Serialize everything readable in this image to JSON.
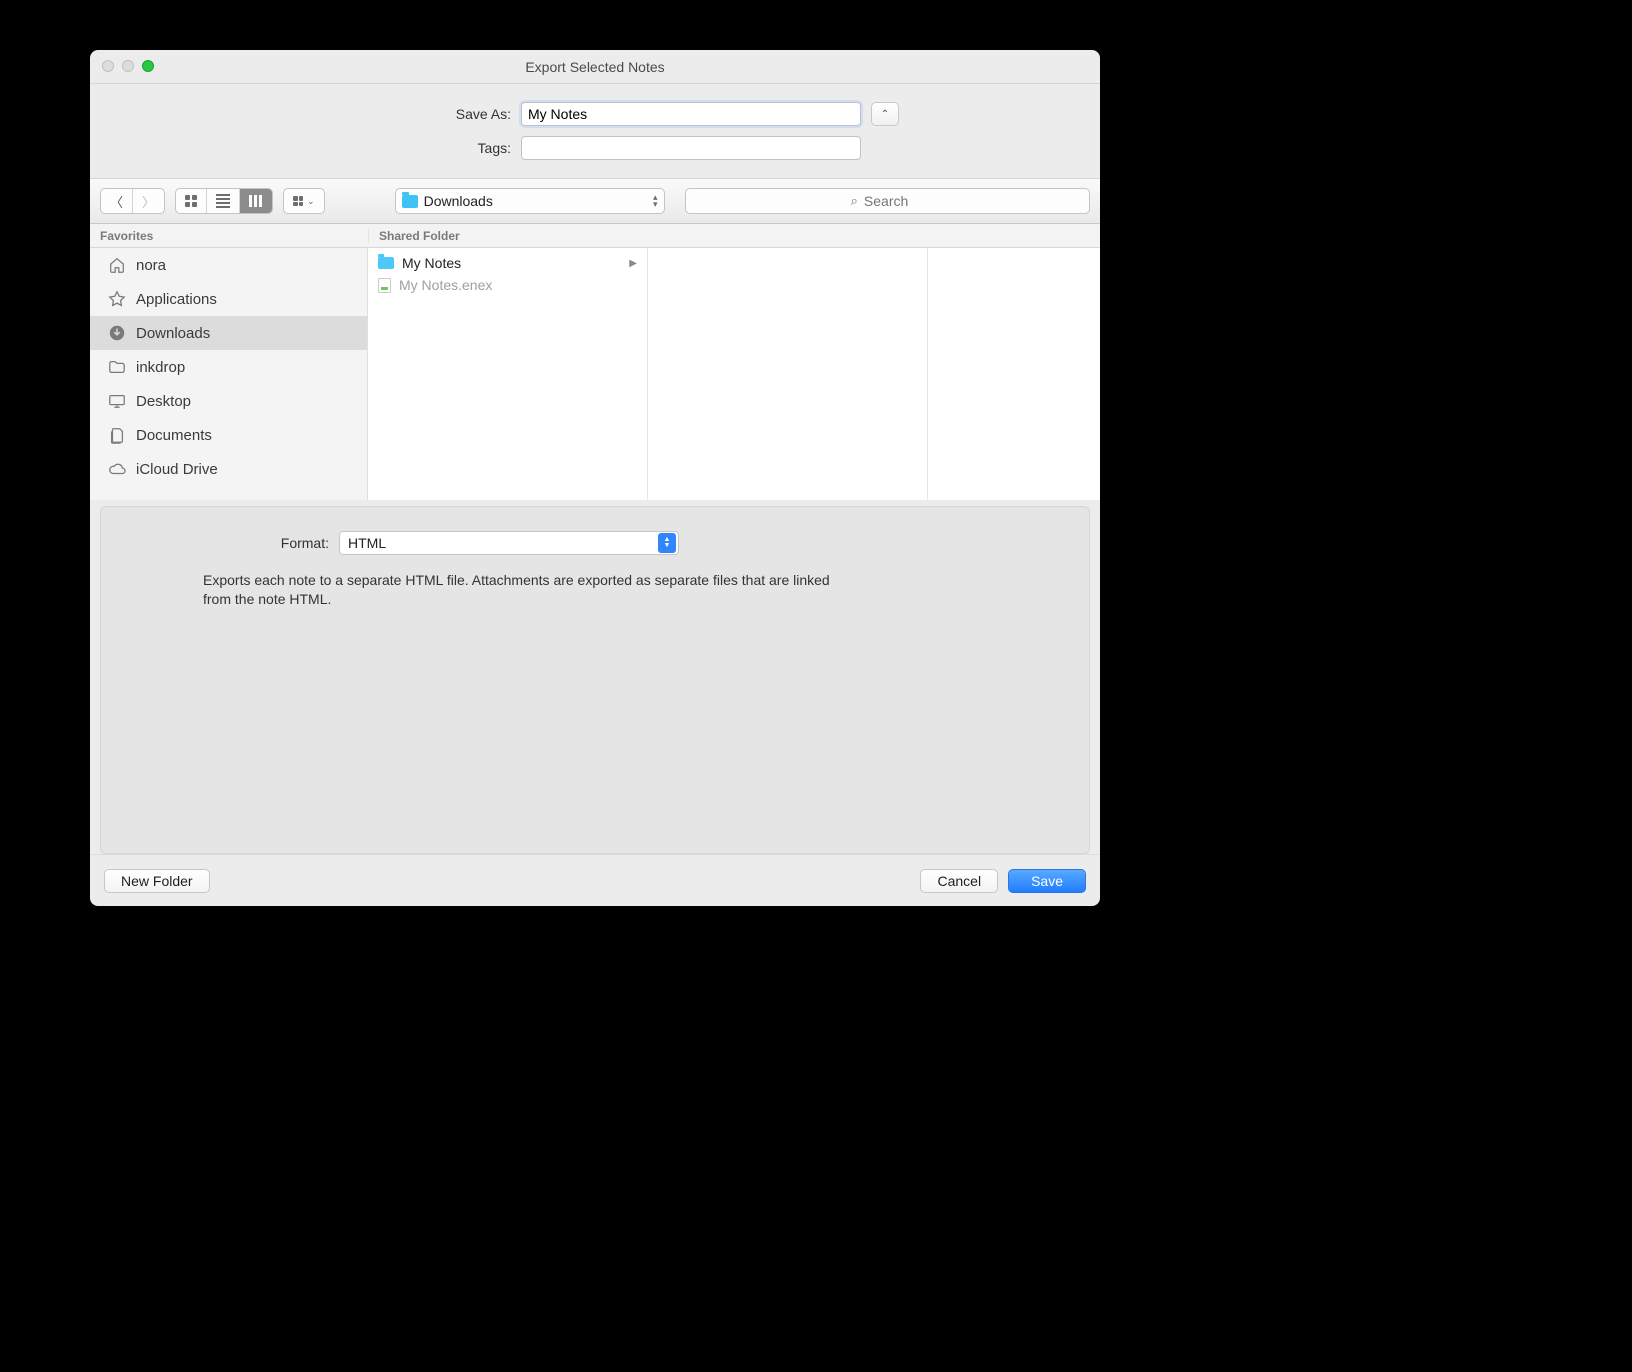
{
  "window": {
    "title": "Export Selected Notes"
  },
  "form": {
    "save_as_label": "Save As:",
    "save_as_value": "My Notes",
    "tags_label": "Tags:",
    "tags_value": ""
  },
  "toolbar": {
    "location": "Downloads",
    "search_placeholder": "Search"
  },
  "sidebar": {
    "section": "Favorites",
    "items": [
      {
        "label": "nora",
        "icon": "home-icon"
      },
      {
        "label": "Applications",
        "icon": "applications-icon"
      },
      {
        "label": "Downloads",
        "icon": "downloads-icon",
        "selected": true
      },
      {
        "label": "inkdrop",
        "icon": "folder-icon"
      },
      {
        "label": "Desktop",
        "icon": "desktop-icon"
      },
      {
        "label": "Documents",
        "icon": "documents-icon"
      },
      {
        "label": "iCloud Drive",
        "icon": "cloud-icon"
      }
    ]
  },
  "column_header": "Shared Folder",
  "file_list": [
    {
      "name": "My Notes",
      "type": "folder"
    },
    {
      "name": "My Notes.enex",
      "type": "file",
      "dimmed": true
    }
  ],
  "format": {
    "label": "Format:",
    "value": "HTML",
    "description": "Exports each note to a separate HTML file.  Attachments are exported as separate files that are linked from the note HTML."
  },
  "buttons": {
    "new_folder": "New Folder",
    "cancel": "Cancel",
    "save": "Save"
  }
}
